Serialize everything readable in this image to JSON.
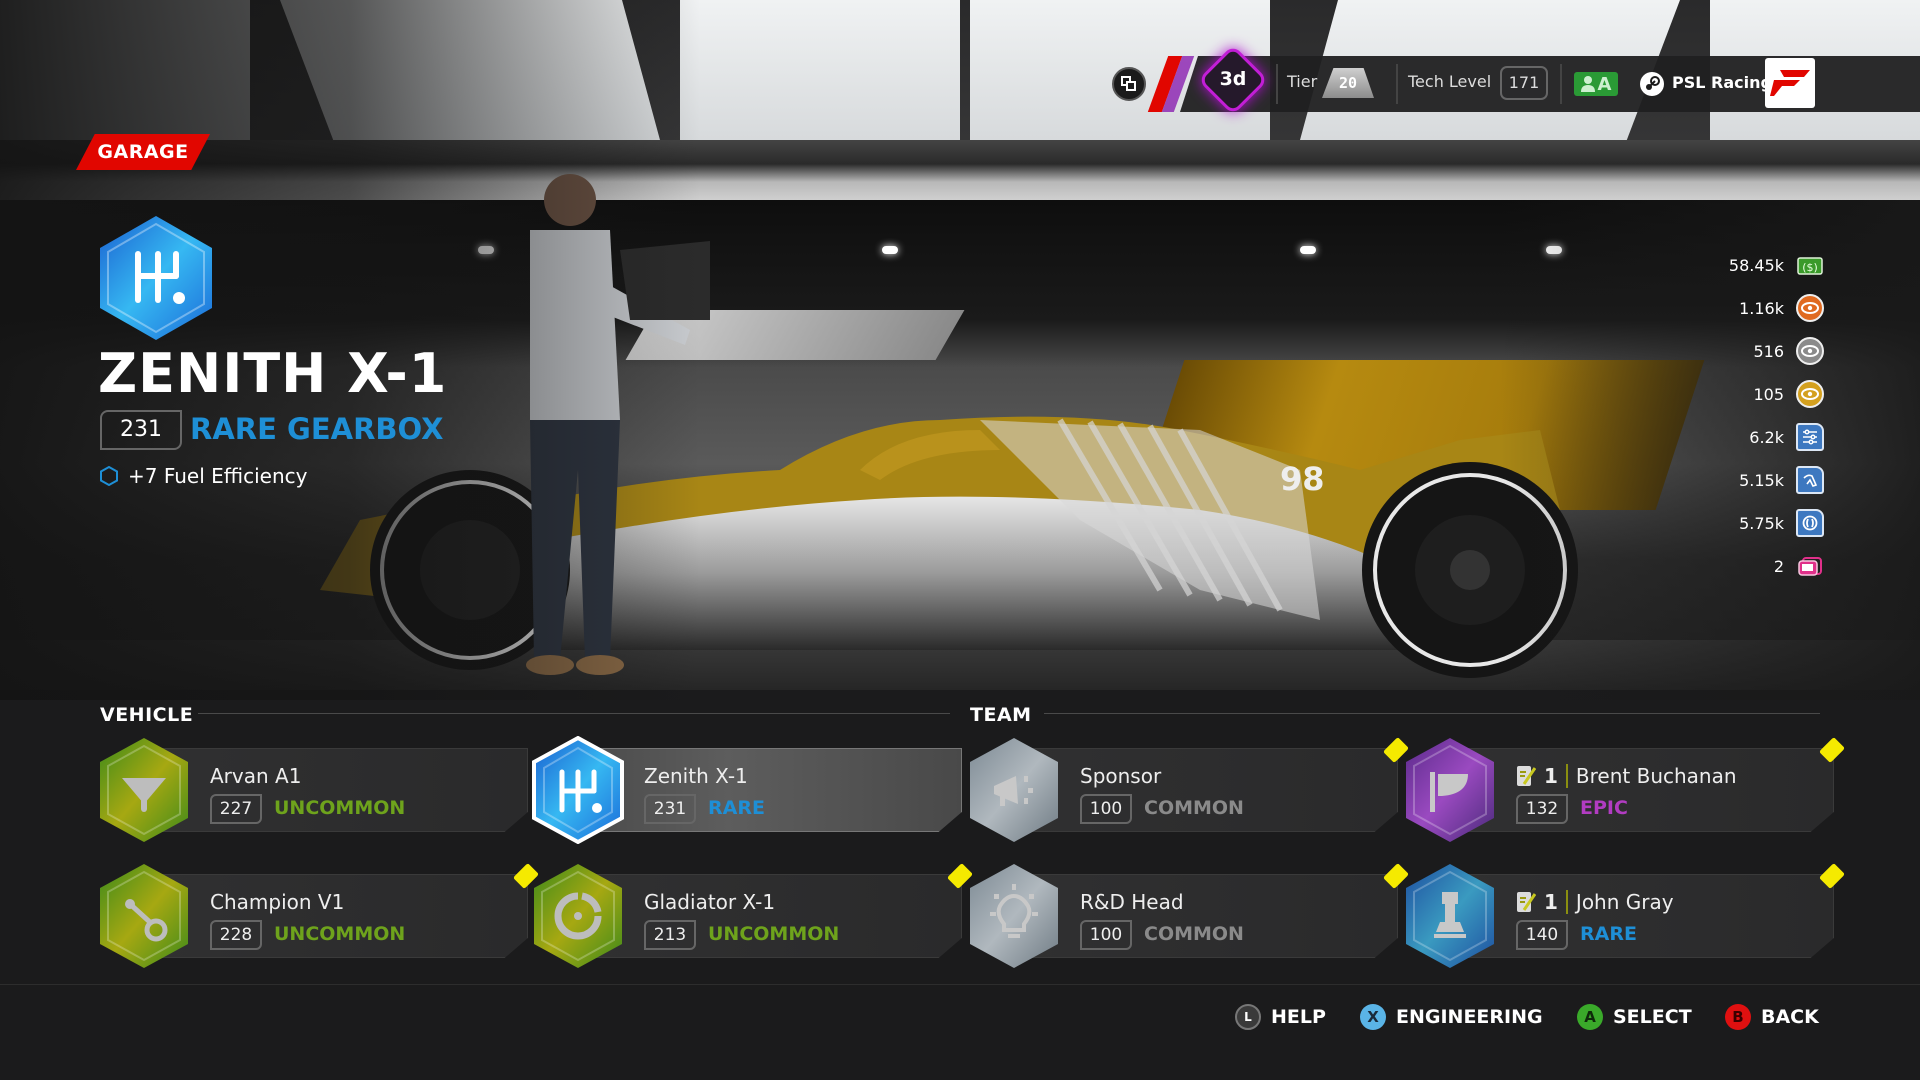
{
  "topbar": {
    "timer": "3d",
    "tier_label": "Tier",
    "tier_value": "20",
    "tech_level_label": "Tech Level",
    "tech_level_value": "171",
    "account_badge": "A",
    "platform_user": "PSL Racing",
    "icons": [
      "toggle-view-icon",
      "steam-icon",
      "f1-logo"
    ]
  },
  "screen_tag": "GARAGE",
  "part": {
    "name": "ZENITH X-1",
    "level": "231",
    "rarity_type": "RARE GEARBOX",
    "stat": "+7 Fuel Efficiency",
    "icon": "gearbox-icon",
    "rarity_color": "#1e8fd6"
  },
  "currencies": [
    {
      "value": "58.45k",
      "icon": "cash-icon",
      "color": "#3a9a2a"
    },
    {
      "value": "1.16k",
      "icon": "eye-orange-icon",
      "color": "#e06a20"
    },
    {
      "value": "516",
      "icon": "eye-silver-icon",
      "color": "#8a8a8a"
    },
    {
      "value": "105",
      "icon": "eye-gold-icon",
      "color": "#d4a01e"
    },
    {
      "value": "6.2k",
      "icon": "settings-sliders-icon",
      "color": "#3d78c0"
    },
    {
      "value": "5.15k",
      "icon": "aero-icon",
      "color": "#3d78c0"
    },
    {
      "value": "5.75k",
      "icon": "tyre-icon",
      "color": "#3d78c0"
    },
    {
      "value": "2",
      "icon": "cards-icon",
      "color": "#e0308a"
    }
  ],
  "sections": {
    "vehicle": "VEHICLE",
    "team": "TEAM"
  },
  "vehicle_cards": [
    {
      "name": "Arvan A1",
      "level": "227",
      "rarity": "UNCOMMON",
      "icon": "brakes-icon",
      "new": false,
      "selected": false
    },
    {
      "name": "Zenith X-1",
      "level": "231",
      "rarity": "RARE",
      "icon": "gearbox-icon",
      "new": false,
      "selected": true
    },
    {
      "name": "Champion V1",
      "level": "228",
      "rarity": "UNCOMMON",
      "icon": "suspension-icon",
      "new": true,
      "selected": false
    },
    {
      "name": "Gladiator X-1",
      "level": "213",
      "rarity": "UNCOMMON",
      "icon": "engine-icon",
      "new": true,
      "selected": false
    }
  ],
  "team_cards": [
    {
      "name": "Sponsor",
      "level": "100",
      "rarity": "COMMON",
      "icon": "megaphone-icon",
      "new": true
    },
    {
      "name": "Brent Buchanan",
      "contract": "1",
      "level": "132",
      "rarity": "EPIC",
      "icon": "flag-icon",
      "new": true
    },
    {
      "name": "R&D Head",
      "level": "100",
      "rarity": "COMMON",
      "icon": "lightbulb-icon",
      "new": true
    },
    {
      "name": "John Gray",
      "contract": "1",
      "level": "140",
      "rarity": "RARE",
      "icon": "chess-rook-icon",
      "new": true
    }
  ],
  "rarity_colors": {
    "UNCOMMON": "#6ea31c",
    "RARE": "#1e8fd6",
    "COMMON": "#8a8a8a",
    "EPIC": "#b23cc2"
  },
  "footer": [
    {
      "key": "L",
      "label": "HELP",
      "color": "#3a3a3a"
    },
    {
      "key": "X",
      "label": "ENGINEERING",
      "color": "#5ab4e6"
    },
    {
      "key": "A",
      "label": "SELECT",
      "color": "#3aaa2a"
    },
    {
      "key": "B",
      "label": "BACK",
      "color": "#e01010"
    }
  ]
}
